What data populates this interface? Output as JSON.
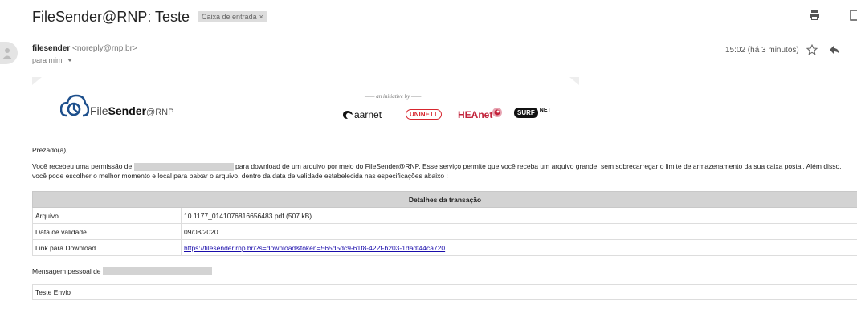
{
  "email": {
    "subject": "FileSender@RNP: Teste",
    "label_chip": "Caixa de entrada",
    "label_remove": "×",
    "sender_name": "filesender",
    "sender_address": "<noreply@rnp.br>",
    "to_line": "para mim",
    "timestamp": "15:02 (há 3 minutos)"
  },
  "icons": {
    "print": "print-icon",
    "new_window": "new-window-icon",
    "star": "star-icon",
    "reply": "reply-icon",
    "avatar": "avatar-icon"
  },
  "banner": {
    "logo_word_plain": "File",
    "logo_word_bold": "Sender",
    "logo_suffix": "@RNP",
    "initiative_text": "an initiative by",
    "partners": {
      "aarnet": "aarnet",
      "uninett": "UNINETT",
      "heanet": "HEAnet",
      "surf": "SURF",
      "net": "NET"
    }
  },
  "message": {
    "greeting": "Prezado(a),",
    "para_part1": "Você recebeu uma permissão de",
    "para_part2": "para download de um arquivo por meio do FileSender@RNP. Esse serviço permite que você receba um arquivo grande, sem sobrecarregar o limite de armazenamento da sua caixa postal. Além disso, você pode escolher o melhor momento e local para baixar o arquivo, dentro da data de validade estabelecida nas especificações abaixo :",
    "personal_message_label": "Mensagem pessoal de",
    "personal_message_body": "Teste Envio"
  },
  "details": {
    "header": "Detalhes da transação",
    "rows": [
      {
        "key": "Arquivo",
        "value": "10.1177_0141076816656483.pdf (507 kB)"
      },
      {
        "key": "Data de validade",
        "value": "09/08/2020"
      },
      {
        "key": "Link para Download",
        "value": "https://filesender.rnp.br/?s=download&token=565d5dc9-61f8-422f-b203-1dadf44ca720"
      }
    ]
  },
  "colors": {
    "table_header_bg": "#d3d3d3",
    "link": "#1a0dab",
    "uninett_red": "#d7262e",
    "heanet_red": "#c2223a",
    "fs_logo_blue": "#1d4f8c"
  }
}
